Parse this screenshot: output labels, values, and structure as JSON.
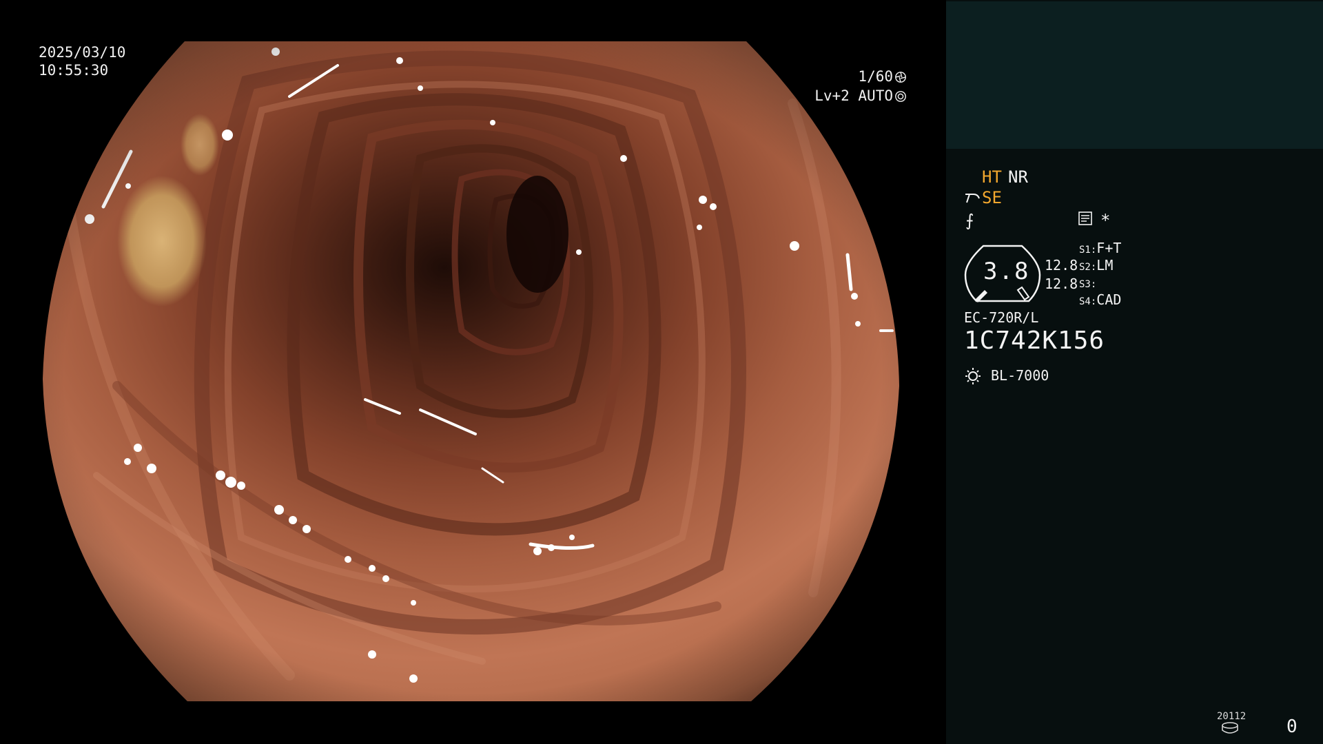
{
  "osd": {
    "date": "2025/03/10",
    "time": "10:55:30",
    "shutter": "1/60",
    "shutter_icon": "shutter-icon",
    "iris": "Lv+2 AUTO",
    "iris_icon": "iris-icon"
  },
  "status": {
    "ht": "HT",
    "nr": "NR",
    "se": "SE",
    "se_icon": "scope-tool-icon",
    "e_icon": "enhancement-icon",
    "e_symbol": "⨍",
    "doc_icon": "document-icon",
    "star": "*"
  },
  "gauge": {
    "value": "3.8",
    "left": "12.8",
    "right": "12.8"
  },
  "slots": [
    {
      "label": "S1:",
      "value": "F+T"
    },
    {
      "label": "S2:",
      "value": "LM"
    },
    {
      "label": "S3:",
      "value": ""
    },
    {
      "label": "S4:",
      "value": "CAD"
    }
  ],
  "scope": {
    "model": "EC-720R/L",
    "serial": "1C742K156"
  },
  "light": {
    "icon": "light-source-icon",
    "name": "BL-7000"
  },
  "counter": {
    "code": "20112",
    "icon": "storage-icon",
    "value": "0"
  },
  "colors": {
    "accent_amber": "#f2a72e",
    "panel_bg": "#070f0f",
    "panel_top_bg": "#0c1f20",
    "tissue": "#b06848"
  }
}
